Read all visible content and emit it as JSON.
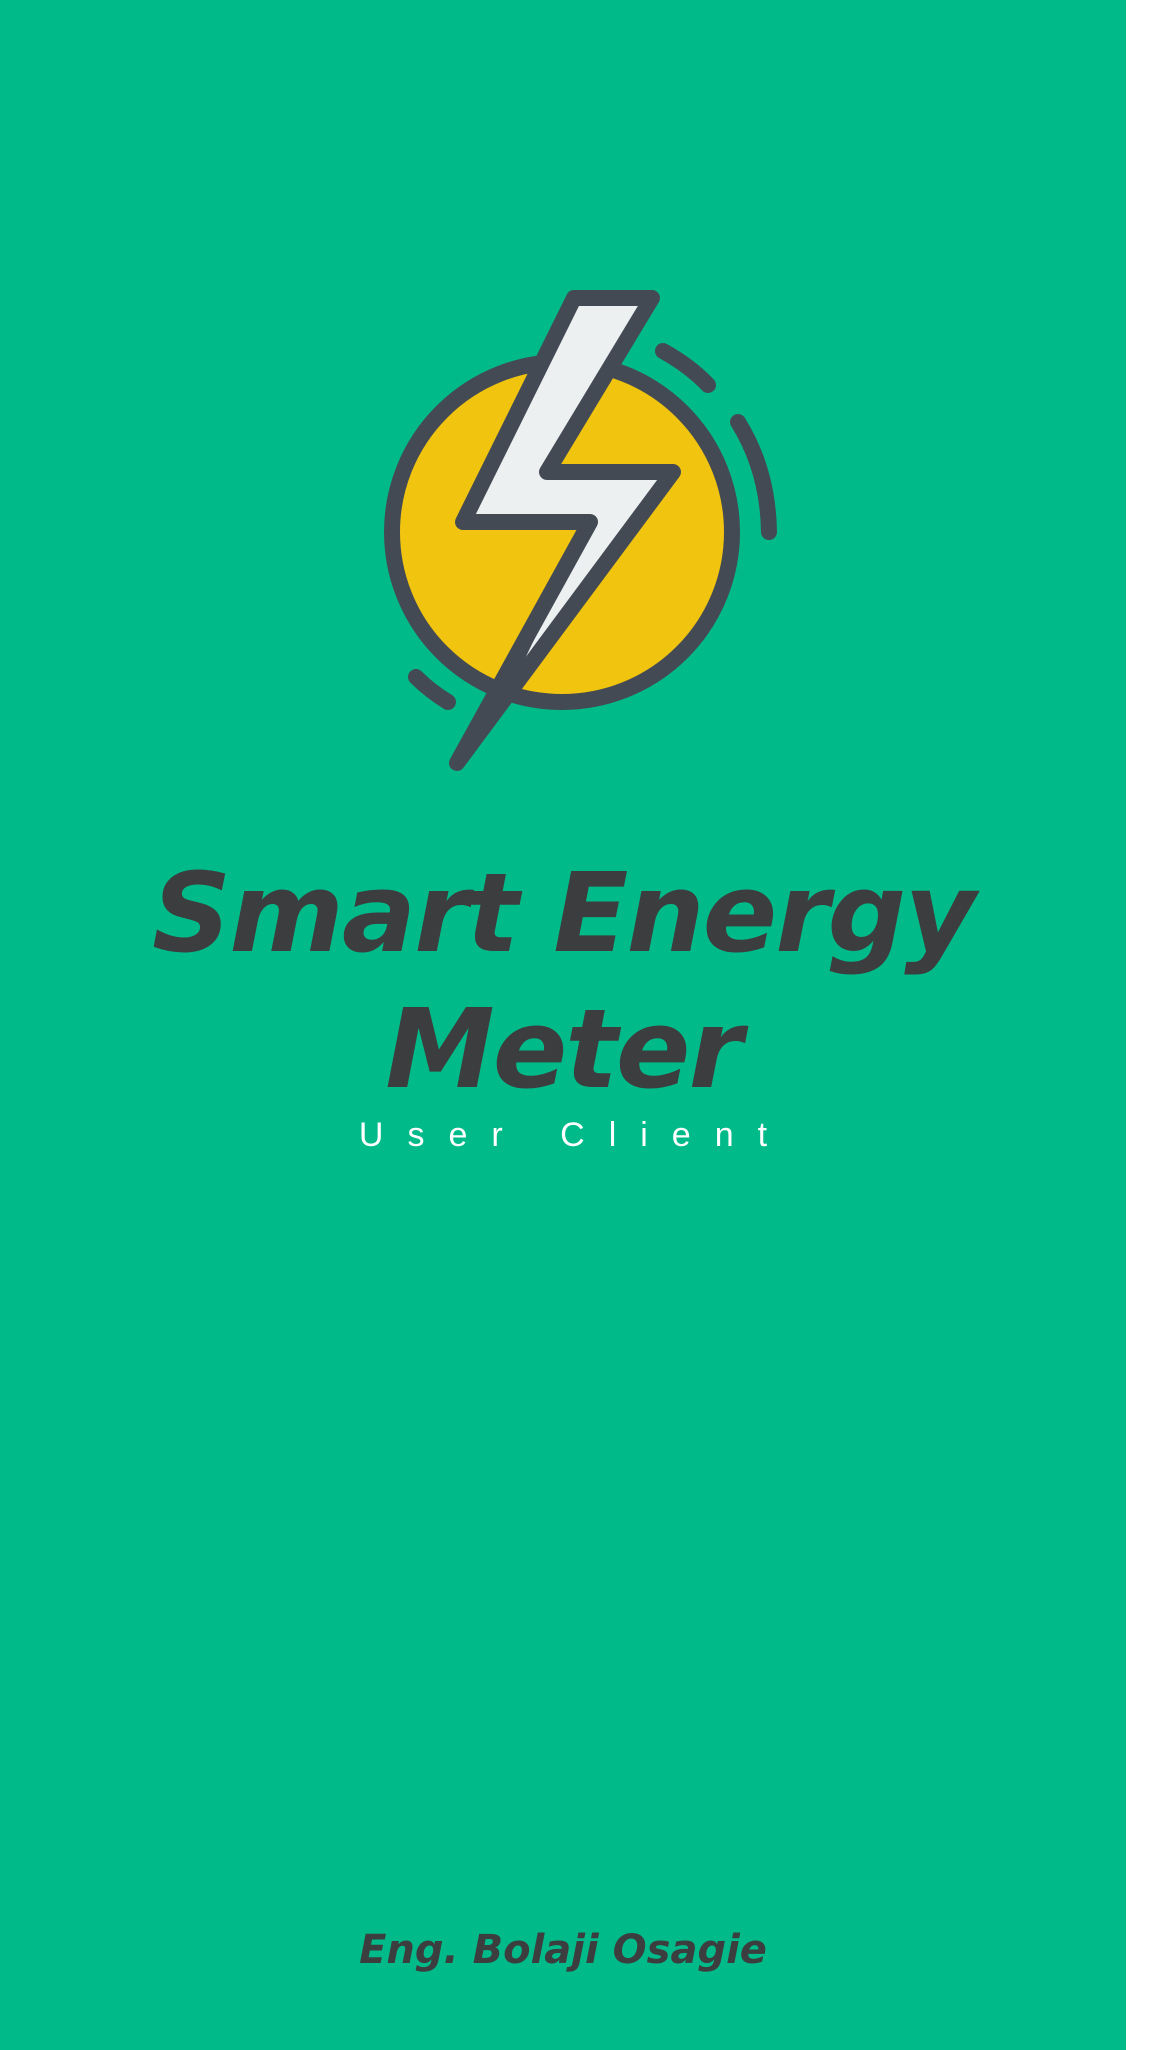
{
  "app": {
    "title": "Smart Energy Meter",
    "subtitle": "User Client",
    "author": "Eng. Bolaji Osagie"
  },
  "logo": {
    "icon": "lightning-bolt-icon",
    "colors": {
      "background": "#00bb89",
      "circle": "#f1c40f",
      "bolt": "#ecf0f1",
      "outline": "#434a54"
    }
  }
}
